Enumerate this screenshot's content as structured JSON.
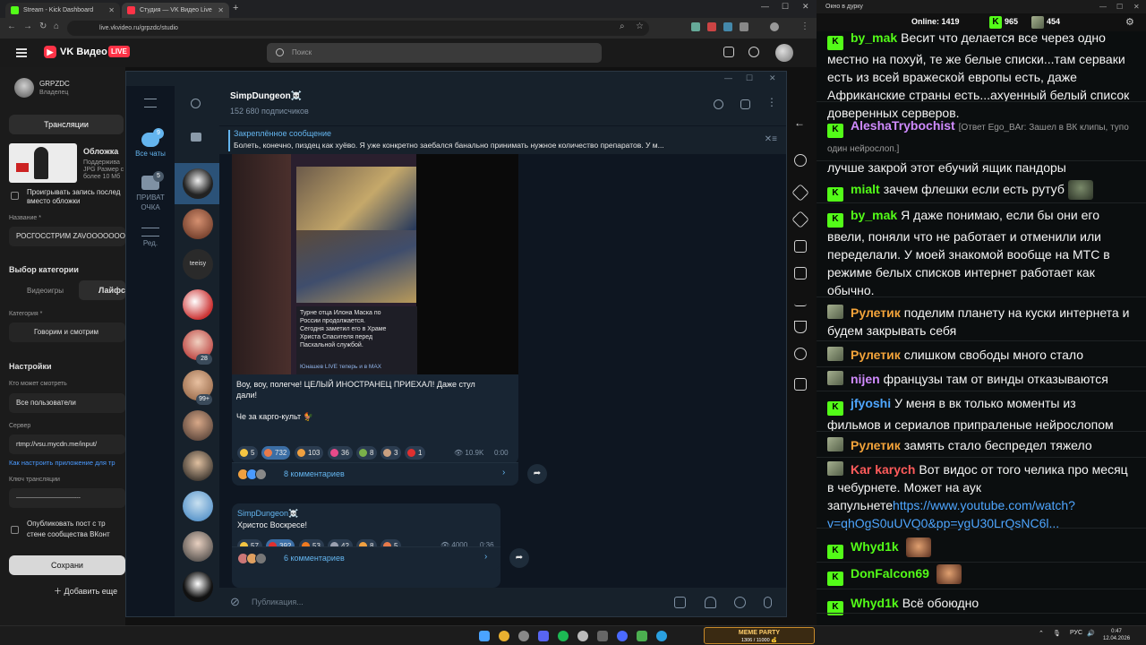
{
  "browser": {
    "tabs": [
      {
        "label": "Stream - Kick Dashboard",
        "color": "#53fc18"
      },
      {
        "label": "Студия — VK Видео Live",
        "color": "#ff3347"
      }
    ],
    "new_tab": "+",
    "url": "live.vkvideo.ru/grpzdc/studio"
  },
  "vk": {
    "brand": "VK Видео",
    "live_badge": "LIVE",
    "search_placeholder": "Поиск"
  },
  "studio": {
    "channel_name": "GRPZDC",
    "channel_role": "Владелец",
    "tab_label": "Трансляции",
    "cover_title": "Обложка",
    "cover_hint1": "Поддержива",
    "cover_hint2": "JPG Размер с",
    "cover_hint3": "более 10 Мб",
    "replay_check": "Проигрывать запись послед",
    "replay_check2": "вместо обложки",
    "name_label": "Название *",
    "name_value": "РОСГОССТРИМ ZAVOOOOOOOZ",
    "category_choice_label": "Выбор категории",
    "cat_games": "Видеоигры",
    "cat_life": "Лайфст",
    "category_label": "Категория *",
    "category_value": "Говорим и смотрим",
    "settings_label": "Настройки",
    "who_can_watch_label": "Кто может смотреть",
    "who_can_watch_value": "Все пользователи",
    "server_label": "Сервер",
    "server_value": "rtmp://vsu.mycdn.me/input/",
    "howto_link": "Как настроить приложение для тр",
    "key_label": "Ключ трансляции",
    "key_value": "------------------------------------",
    "publish_check1": "Опубликовать пост с тр",
    "publish_check2": "стене сообщества ВКонт",
    "save_button": "Сохрани",
    "add_more": "Добавить еще"
  },
  "telegram": {
    "folders": [
      {
        "label": "Все чаты",
        "badge": "9",
        "active": true
      },
      {
        "label": "ПРИВАТ ОЧКА",
        "badge": "5",
        "active": false
      },
      {
        "label": "Ред.",
        "badge": "",
        "active": false
      }
    ],
    "chat_badges": {
      "c6": "28",
      "c7": "99+"
    },
    "channel_name": "SimpDungeon☠️",
    "subscribers": "152 680 подписчиков",
    "pinned_title": "Закреплённое сообщение",
    "pinned_text": "Болеть, конечно, пиздец как хуёво. Я уже конкретно заебался банально принимать нужное количество препаратов. У м...",
    "post1": {
      "image_caption": "Турне отца Илона Маска по\nРоссии продолжается.\nСегодня заметил его в Храме\nХриста Спасителя перед\nПасхальной службой.",
      "image_footer": "Юнашев LIVE теперь и в MAX",
      "text": "Воу, воу, полегче! ЦЕЛЫЙ ИНОСТРАНЕЦ ПРИЕХАЛ! Даже стул\nдали!\n\nЧе за карго-культ 🐓",
      "reactions": [
        {
          "count": "5",
          "color": "#f5c542"
        },
        {
          "count": "732",
          "color": "#e87a4a"
        },
        {
          "count": "103",
          "color": "#f0a040"
        },
        {
          "count": "36",
          "color": "#e84a8a"
        },
        {
          "count": "8",
          "color": "#7ab04a"
        },
        {
          "count": "3",
          "color": "#caa080"
        },
        {
          "count": "1",
          "color": "#e03030"
        }
      ],
      "views": "10.9K",
      "time": "0:00",
      "comments": "8 комментариев"
    },
    "post2": {
      "author": "SimpDungeon☠️",
      "text": "Христос Воскресе!",
      "reactions": [
        {
          "count": "57",
          "color": "#f5c542"
        },
        {
          "count": "392",
          "color": "#e03030"
        },
        {
          "count": "53",
          "color": "#f07a20"
        },
        {
          "count": "42",
          "color": "#9aa0b0"
        },
        {
          "count": "8",
          "color": "#f0a040"
        },
        {
          "count": "5",
          "color": "#e87a4a"
        }
      ],
      "views": "4000",
      "time": "0:36",
      "comments": "6 комментариев"
    },
    "compose_placeholder": "Публикация..."
  },
  "kick": {
    "window_title": "Окно в дурку",
    "online_label": "Online:",
    "online_count": "1419",
    "stat1": "965",
    "stat2": "454",
    "messages": [
      {
        "user": "by_mak",
        "text": "Весит что делается все через одно местно на похуй, те же белые списки...там серваки есть из всей вражеской европы есть, даже Африканские страны есть...ахуенный белый список доверенных серверов.",
        "color": "g"
      },
      {
        "user": "AleshaTrybochist",
        "reply": "[Ответ Ego_BAr: Зашел в ВК клипы, тупо один нейрослоп.]",
        "text": "лучше закрой этот ебучий ящик пандоры",
        "color": "c"
      },
      {
        "user": "mialt",
        "text": "зачем флешки если есть рутуб",
        "color": "g"
      },
      {
        "user": "by_mak",
        "text": "Я даже понимаю, если бы они его ввели, поняли что не работает и отменили или переделали. У моей знакомой вообще на МТС в режиме белых списков интернет работает как обычно.",
        "color": "g"
      },
      {
        "user": "Рулетик",
        "text": "поделим планету на куски интернета и будем закрывать себя",
        "color": "o"
      },
      {
        "user": "Рулетик",
        "text": "слишком свободы много стало",
        "color": "o"
      },
      {
        "user": "nijen",
        "text": "французы там от винды отказываются",
        "color": "c"
      },
      {
        "user": "jfyoshi",
        "text": "У меня в вк только моменты из фильмов и сериалов припраленые нейрослопом",
        "color": "b"
      },
      {
        "user": "Рулетик",
        "text": "замять стало беспредел тяжело",
        "color": "o"
      },
      {
        "user": "Kar karych",
        "text": "Вот видос от того челика про месяц в чебурнете. Может на аук запульнете",
        "link": "https://www.youtube.com/watch?v=qhOgS0uUVQ0&pp=ygU30LrQsNC6l...",
        "color": "r"
      },
      {
        "user": "Whyd1k",
        "text": "",
        "color": "g"
      },
      {
        "user": "DonFalcon69",
        "text": "",
        "color": "g"
      },
      {
        "user": "Whyd1k",
        "text": "Всё обоюдно",
        "color": "g"
      }
    ]
  },
  "taskbar": {
    "meme_title": "MEME PARTY",
    "meme_sub": "1306 / 11000 💰",
    "lang": "РУС",
    "time": "0:47",
    "date": "12.04.2026"
  }
}
